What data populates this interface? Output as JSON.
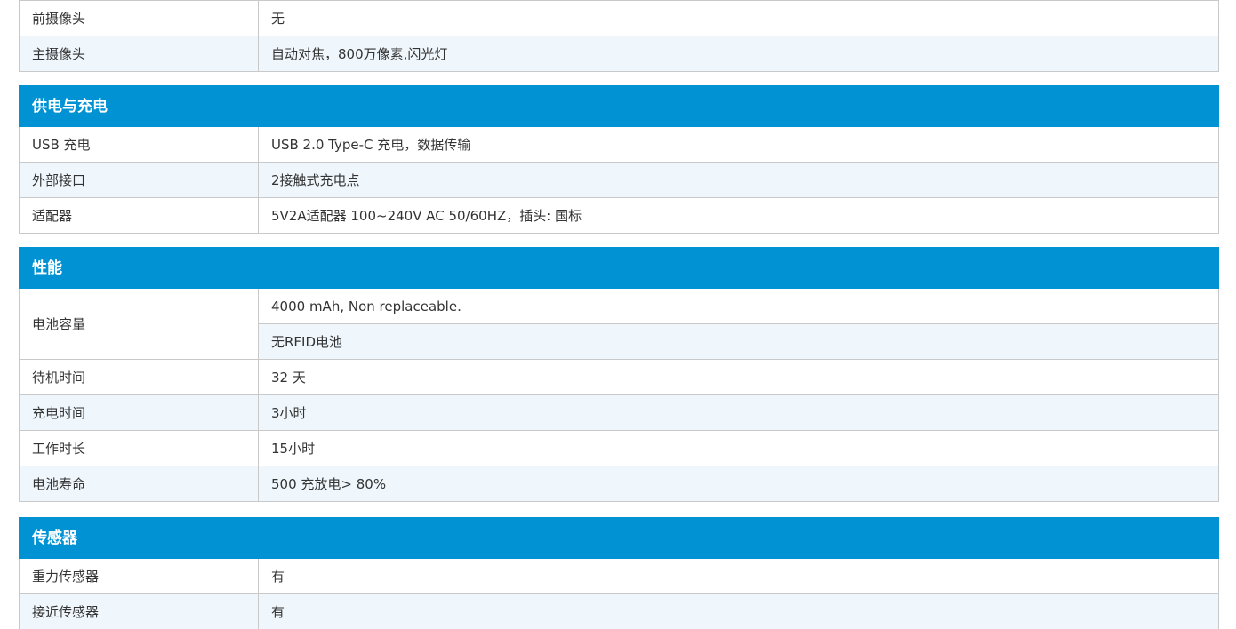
{
  "colors": {
    "header_bg": "#0092d3",
    "header_text": "#ffffff",
    "row_alt_bg": "#eff7fd",
    "border": "#c9c9c9"
  },
  "camera": {
    "rows": [
      {
        "label": "前摄像头",
        "value": "无"
      },
      {
        "label": "主摄像头",
        "value": "自动对焦，800万像素,闪光灯"
      }
    ]
  },
  "power": {
    "title": "供电与充电",
    "rows": [
      {
        "label": "USB 充电",
        "value": "USB 2.0 Type-C 充电，数据传输"
      },
      {
        "label": "外部接口",
        "value": "2接触式充电点"
      },
      {
        "label": "适配器",
        "value": "5V2A适配器 100~240V AC 50/60HZ，插头: 国标"
      }
    ]
  },
  "performance": {
    "title": "性能",
    "battery": {
      "label": "电池容量",
      "values": [
        "4000 mAh, Non replaceable.",
        "无RFID电池"
      ]
    },
    "rows": [
      {
        "label": "待机时间",
        "value": "32 天"
      },
      {
        "label": "充电时间",
        "value": "3小时"
      },
      {
        "label": "工作时长",
        "value": "15小时"
      },
      {
        "label": "电池寿命",
        "value": "500 充放电> 80%"
      }
    ]
  },
  "sensors": {
    "title": "传感器",
    "rows": [
      {
        "label": "重力传感器",
        "value": "有"
      },
      {
        "label": "接近传感器",
        "value": "有"
      }
    ]
  }
}
